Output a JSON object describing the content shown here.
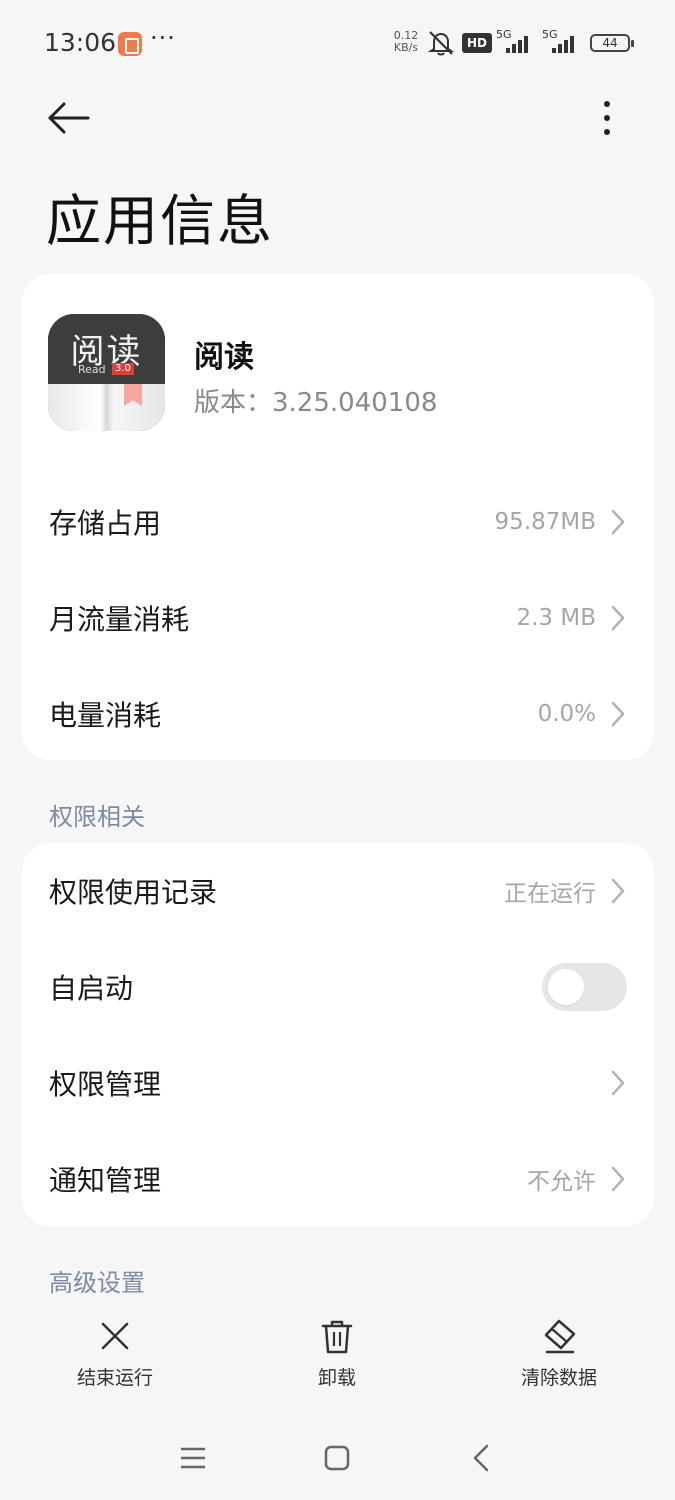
{
  "status_bar": {
    "time": "13:06",
    "dots": "···",
    "net_speed_value": "0.12",
    "net_speed_unit": "KB/s",
    "hd_label": "HD",
    "sim1_label": "5G",
    "sim2_label": "5G",
    "battery": "44",
    "icons": [
      "app-notification-icon",
      "mute-bell-icon",
      "hd-icon",
      "signal-icon",
      "battery-icon"
    ]
  },
  "header": {
    "title": "应用信息",
    "back_icon": "arrow-left-icon",
    "more_icon": "more-vertical-icon"
  },
  "app": {
    "name": "阅读",
    "version": "版本：3.25.040108",
    "icon_title": "阅读",
    "icon_read": "Read",
    "icon_version_badge": "3.0"
  },
  "usage_rows": [
    {
      "label": "存储占用",
      "value": "95.87MB"
    },
    {
      "label": "月流量消耗",
      "value": "2.3 MB"
    },
    {
      "label": "电量消耗",
      "value": "0.0%"
    }
  ],
  "permissions_section": {
    "title": "权限相关",
    "rows": [
      {
        "label": "权限使用记录",
        "value": "正在运行"
      },
      {
        "label": "自启动",
        "toggle": false
      },
      {
        "label": "权限管理",
        "value": ""
      },
      {
        "label": "通知管理",
        "value": "不允许"
      }
    ]
  },
  "advanced_section": {
    "title": "高级设置"
  },
  "actions": [
    {
      "label": "结束运行",
      "icon": "close-icon"
    },
    {
      "label": "卸载",
      "icon": "trash-icon"
    },
    {
      "label": "清除数据",
      "icon": "eraser-icon"
    }
  ],
  "nav_bar": {
    "icons": [
      "menu-icon",
      "home-icon",
      "back-icon"
    ]
  },
  "colors": {
    "background": "#f6f6f6",
    "card": "#ffffff",
    "section_title": "#7d8aa5",
    "secondary_text": "#a6a6a6"
  }
}
